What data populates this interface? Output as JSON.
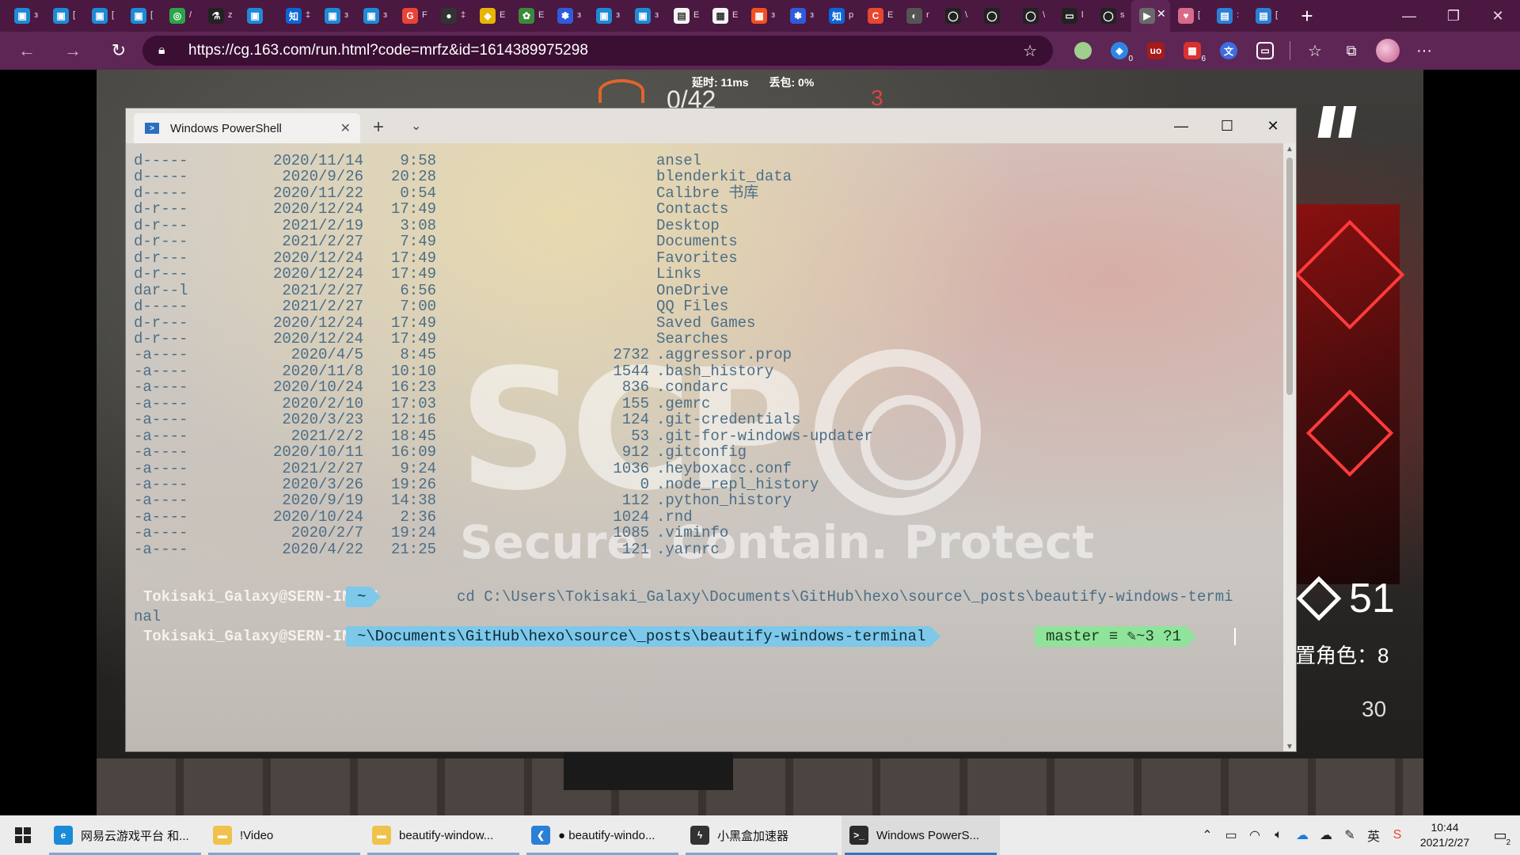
{
  "browser": {
    "tabs": [
      {
        "icon": "bilibili-icon",
        "color": "#1e8ad6",
        "glyph": "▣",
        "trunc": "з"
      },
      {
        "icon": "bilibili-icon",
        "color": "#1e8ad6",
        "glyph": "▣",
        "trunc": "["
      },
      {
        "icon": "bilibili-icon",
        "color": "#1e8ad6",
        "glyph": "▣",
        "trunc": "["
      },
      {
        "icon": "bilibili-icon",
        "color": "#1e8ad6",
        "glyph": "▣",
        "trunc": "["
      },
      {
        "icon": "chrome-like-icon",
        "color": "#2aa54a",
        "glyph": "◎",
        "trunc": "/"
      },
      {
        "icon": "flask-icon",
        "color": "#222222",
        "glyph": "⚗",
        "trunc": "z"
      },
      {
        "icon": "bilibili-icon",
        "color": "#1e8ad6",
        "glyph": "▣",
        "trunc": ""
      },
      {
        "icon": "zhihu-icon",
        "color": "#0a66d8",
        "glyph": "知",
        "trunc": "‡"
      },
      {
        "icon": "bilibili-icon",
        "color": "#1e8ad6",
        "glyph": "▣",
        "trunc": "з"
      },
      {
        "icon": "bilibili-icon",
        "color": "#1e8ad6",
        "glyph": "▣",
        "trunc": "з"
      },
      {
        "icon": "google-icon",
        "color": "#ea4335",
        "glyph": "G",
        "trunc": "F"
      },
      {
        "icon": "github-icon",
        "color": "#333333",
        "glyph": "●",
        "trunc": "‡"
      },
      {
        "icon": "yellow-app-icon",
        "color": "#e9b400",
        "glyph": "◆",
        "trunc": "E"
      },
      {
        "icon": "plant-icon",
        "color": "#3b8a3b",
        "glyph": "✿",
        "trunc": "E"
      },
      {
        "icon": "baidu-icon",
        "color": "#2e5bd9",
        "glyph": "✽",
        "trunc": "з"
      },
      {
        "icon": "bilibili-icon",
        "color": "#1e8ad6",
        "glyph": "▣",
        "trunc": "з"
      },
      {
        "icon": "bilibili-icon",
        "color": "#1e8ad6",
        "glyph": "▣",
        "trunc": "з"
      },
      {
        "icon": "document-icon",
        "color": "#f4f4f4",
        "glyph": "▤",
        "trunc": "E"
      },
      {
        "icon": "document-icon",
        "color": "#f4f4f4",
        "glyph": "▦",
        "trunc": "E"
      },
      {
        "icon": "microsoft-icon",
        "color": "#f25022",
        "glyph": "▦",
        "trunc": "з"
      },
      {
        "icon": "baidu-icon",
        "color": "#2e5bd9",
        "glyph": "✽",
        "trunc": "з"
      },
      {
        "icon": "zhihu-icon",
        "color": "#0a66d8",
        "glyph": "知",
        "trunc": "p"
      },
      {
        "icon": "csdn-icon",
        "color": "#e8462f",
        "glyph": "C",
        "trunc": "E"
      },
      {
        "icon": "moon-icon",
        "color": "#555555",
        "glyph": "◐",
        "trunc": "r"
      },
      {
        "icon": "github-icon",
        "color": "#222222",
        "glyph": "◯",
        "trunc": "\\"
      },
      {
        "icon": "github-icon",
        "color": "#222222",
        "glyph": "◯",
        "trunc": ""
      },
      {
        "icon": "github-icon",
        "color": "#222222",
        "glyph": "◯",
        "trunc": "\\"
      },
      {
        "icon": "terminal-icon",
        "color": "#222222",
        "glyph": "▭",
        "trunc": "l"
      },
      {
        "icon": "github-icon",
        "color": "#222222",
        "glyph": "◯",
        "trunc": "s"
      },
      {
        "icon": "game-icon",
        "color": "#6a6a6a",
        "glyph": "▶",
        "trunc": ""
      },
      {
        "icon": "anime-icon",
        "color": "#d86a8a",
        "glyph": "♥",
        "trunc": "["
      },
      {
        "icon": "doc-blue-icon",
        "color": "#2b7fd6",
        "glyph": "▤",
        "trunc": ":"
      },
      {
        "icon": "doc-blue-icon",
        "color": "#2b7fd6",
        "glyph": "▤",
        "trunc": "["
      }
    ],
    "active_tab_index": 29,
    "url": "https://cg.163.com/run.html?code=mrfz&id=1614389975298",
    "ext_badges": {
      "ext2": "0",
      "ext4": "6"
    }
  },
  "game": {
    "ping_label": "延时: 11ms",
    "loss_label": "丢包: 0%",
    "enemy_count": "0/42",
    "life_points": "3",
    "deploy_cost": "51",
    "deploy_limit": "置角色：8",
    "slot_number": "30"
  },
  "terminal": {
    "tab_title": "Windows PowerShell",
    "rows": [
      {
        "mode": "d-----",
        "date": "2020/11/14",
        "time": "9:58",
        "length": "",
        "name": "ansel"
      },
      {
        "mode": "d-----",
        "date": "2020/9/26",
        "time": "20:28",
        "length": "",
        "name": "blenderkit_data"
      },
      {
        "mode": "d-----",
        "date": "2020/11/22",
        "time": "0:54",
        "length": "",
        "name": "Calibre 书库"
      },
      {
        "mode": "d-r---",
        "date": "2020/12/24",
        "time": "17:49",
        "length": "",
        "name": "Contacts"
      },
      {
        "mode": "d-r---",
        "date": "2021/2/19",
        "time": "3:08",
        "length": "",
        "name": "Desktop"
      },
      {
        "mode": "d-r---",
        "date": "2021/2/27",
        "time": "7:49",
        "length": "",
        "name": "Documents"
      },
      {
        "mode": "d-r---",
        "date": "2020/12/24",
        "time": "17:49",
        "length": "",
        "name": "Favorites"
      },
      {
        "mode": "d-r---",
        "date": "2020/12/24",
        "time": "17:49",
        "length": "",
        "name": "Links"
      },
      {
        "mode": "dar--l",
        "date": "2021/2/27",
        "time": "6:56",
        "length": "",
        "name": "OneDrive"
      },
      {
        "mode": "d-----",
        "date": "2021/2/27",
        "time": "7:00",
        "length": "",
        "name": "QQ Files"
      },
      {
        "mode": "d-r---",
        "date": "2020/12/24",
        "time": "17:49",
        "length": "",
        "name": "Saved Games"
      },
      {
        "mode": "d-r---",
        "date": "2020/12/24",
        "time": "17:49",
        "length": "",
        "name": "Searches"
      },
      {
        "mode": "-a----",
        "date": "2020/4/5",
        "time": "8:45",
        "length": "2732",
        "name": ".aggressor.prop"
      },
      {
        "mode": "-a----",
        "date": "2020/11/8",
        "time": "10:10",
        "length": "1544",
        "name": ".bash_history"
      },
      {
        "mode": "-a----",
        "date": "2020/10/24",
        "time": "16:23",
        "length": "836",
        "name": ".condarc"
      },
      {
        "mode": "-a----",
        "date": "2020/2/10",
        "time": "17:03",
        "length": "155",
        "name": ".gemrc"
      },
      {
        "mode": "-a----",
        "date": "2020/3/23",
        "time": "12:16",
        "length": "124",
        "name": ".git-credentials"
      },
      {
        "mode": "-a----",
        "date": "2021/2/2",
        "time": "18:45",
        "length": "53",
        "name": ".git-for-windows-updater"
      },
      {
        "mode": "-a----",
        "date": "2020/10/11",
        "time": "16:09",
        "length": "912",
        "name": ".gitconfig"
      },
      {
        "mode": "-a----",
        "date": "2021/2/27",
        "time": "9:24",
        "length": "1036",
        "name": ".heyboxacc.conf"
      },
      {
        "mode": "-a----",
        "date": "2020/3/26",
        "time": "19:26",
        "length": "0",
        "name": ".node_repl_history"
      },
      {
        "mode": "-a----",
        "date": "2020/9/19",
        "time": "14:38",
        "length": "112",
        "name": ".python_history"
      },
      {
        "mode": "-a----",
        "date": "2020/10/24",
        "time": "2:36",
        "length": "1024",
        "name": ".rnd"
      },
      {
        "mode": "-a----",
        "date": "2020/2/7",
        "time": "19:24",
        "length": "1085",
        "name": ".viminfo"
      },
      {
        "mode": "-a----",
        "date": "2020/4/22",
        "time": "21:25",
        "length": "121",
        "name": ".yarnrc"
      }
    ],
    "watermark": {
      "letters": "SCP",
      "tagline": "Secure. Contain. Protect"
    },
    "prompt1": {
      "user": "Tokisaki_Galaxy@SERN-INDEX",
      "path": "~",
      "command": "cd C:\\Users\\Tokisaki_Galaxy\\Documents\\GitHub\\hexo\\source\\_posts\\beautify-windows-termi",
      "wrap": "nal"
    },
    "prompt2": {
      "user": "Tokisaki_Galaxy@SERN-INDEX",
      "path": "~\\Documents\\GitHub\\hexo\\source\\_posts\\beautify-windows-terminal",
      "git": "master ≡ ✎~3 ?1"
    }
  },
  "taskbar": {
    "items": [
      {
        "label": "网易云游戏平台 和...",
        "icon": "edge-icon",
        "color": "#1a8bd6",
        "glyph": "e",
        "active": false
      },
      {
        "label": "!Video",
        "icon": "folder-icon",
        "color": "#f0c24b",
        "glyph": "▬",
        "active": false
      },
      {
        "label": "beautify-window...",
        "icon": "folder-icon",
        "color": "#f0c24b",
        "glyph": "▬",
        "active": false
      },
      {
        "label": "● beautify-windo...",
        "icon": "vscode-icon",
        "color": "#2a7fd6",
        "glyph": "❮",
        "active": false
      },
      {
        "label": "小黑盒加速器",
        "icon": "heybox-icon",
        "color": "#333333",
        "glyph": "ϟ",
        "active": false
      },
      {
        "label": "Windows PowerS...",
        "icon": "terminal-icon",
        "color": "#2b2b2b",
        "glyph": ">_",
        "active": true
      }
    ],
    "clock_time": "10:44",
    "clock_date": "2021/2/27",
    "notifications": "2"
  }
}
